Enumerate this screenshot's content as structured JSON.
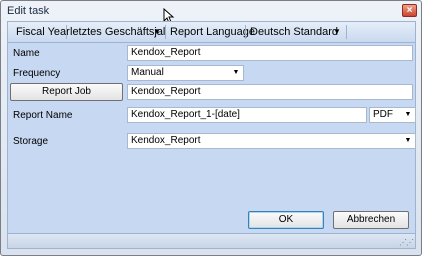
{
  "window": {
    "title": "Edit task",
    "close_glyph": "×"
  },
  "toolbar": {
    "fiscal_year_label": "Fiscal Year",
    "fiscal_year_value": "letztes Geschäftsjal",
    "report_language_label": "Report Language",
    "report_language_value": "Deutsch Standard",
    "dropdown_glyph": "▼"
  },
  "form": {
    "name_label": "Name",
    "name_value": "Kendox_Report",
    "frequency_label": "Frequency",
    "frequency_value": "Manual",
    "report_job_button": "Report Job",
    "report_job_value": "Kendox_Report",
    "report_name_label": "Report Name",
    "report_name_value": "Kendox_Report_1-[date]",
    "format_value": "PDF",
    "storage_label": "Storage",
    "storage_value": "Kendox_Report"
  },
  "buttons": {
    "ok": "OK",
    "cancel": "Abbrechen"
  },
  "icons": {
    "close": "close-icon",
    "dropdown": "chevron-down-icon",
    "resize": "resize-grip-icon",
    "cursor": "mouse-pointer-icon"
  }
}
